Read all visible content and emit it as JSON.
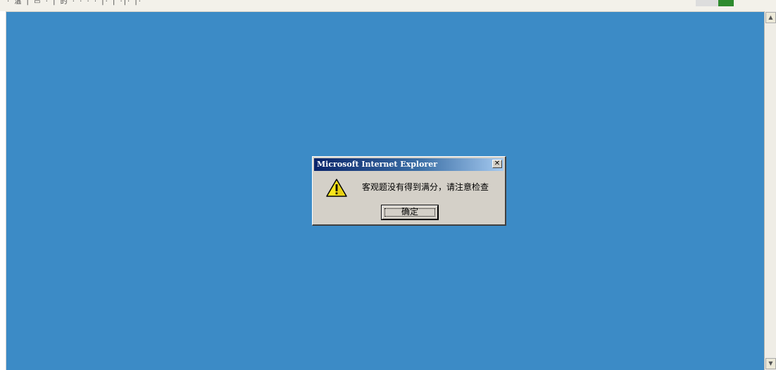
{
  "browser": {
    "crumbs": "· 温 | ▭ · | 的    · ·  ·  ·  |·  |  ·|·  |·"
  },
  "dialog": {
    "title": "Microsoft Internet Explorer",
    "close_label": "✕",
    "message": "客观题没有得到满分，请注意检查",
    "ok_label": "确定",
    "icon": "warning-icon"
  },
  "colors": {
    "page_background": "#3c8bc6",
    "dialog_face": "#d4d0c8",
    "title_start": "#0a246a",
    "title_end": "#a6caf0"
  }
}
